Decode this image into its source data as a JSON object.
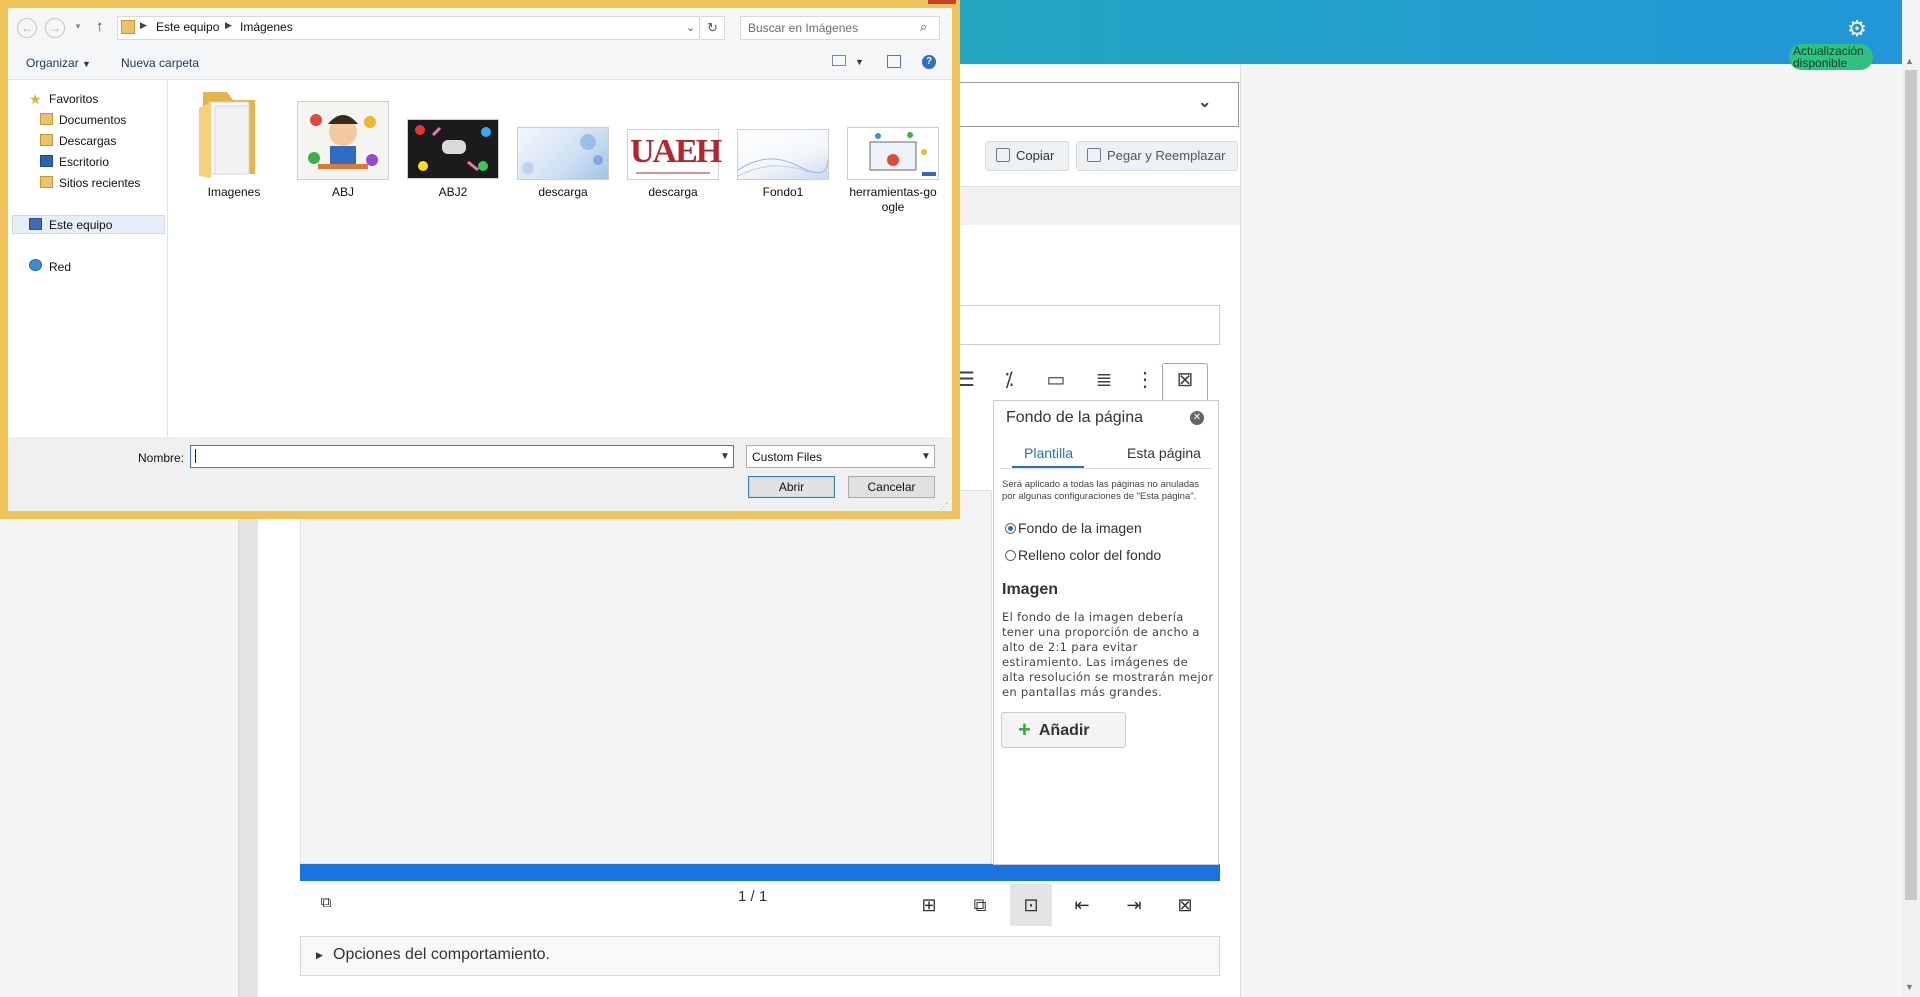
{
  "app": {
    "update_badge": "Actualización disponible",
    "dropdown_chev": "⌄",
    "copy_label": "Copiar",
    "paste_label": "Pegar y Reemplazar",
    "page_indicator": "1 / 1",
    "options_label": "Opciones del comportamiento.",
    "accent_color": "#1a74e0"
  },
  "panel": {
    "title": "Fondo de la página",
    "tabs": [
      "Plantilla",
      "Esta página"
    ],
    "active_tab": "Plantilla",
    "note": "Será aplicado a todas las páginas no anuladas por algunas configuraciones de \"Esta página\".",
    "radio_options": [
      "Fondo de la imagen",
      "Relleno color del fondo"
    ],
    "selected_radio": "Fondo de la imagen",
    "section_heading": "Imagen",
    "section_desc": "El fondo de la imagen debería tener una proporción de ancho a alto de 2:1 para evitar estiramiento. Las imágenes de alta resolución se mostrarán mejor en pantallas más grandes.",
    "add_label": "Añadir"
  },
  "dialog": {
    "address": [
      "Este equipo",
      "Imágenes"
    ],
    "search_placeholder": "Buscar en Imágenes",
    "organize_label": "Organizar",
    "new_folder_label": "Nueva carpeta",
    "tree": {
      "favorites": "Favoritos",
      "documents": "Documentos",
      "downloads": "Descargas",
      "desktop": "Escritorio",
      "recent": "Sitios recientes",
      "this_pc": "Este equipo",
      "network": "Red"
    },
    "files": [
      "Imagenes",
      "ABJ",
      "ABJ2",
      "descarga",
      "descarga",
      "Fondo1",
      "herramientas-google"
    ],
    "file_label_herramientas_line1": "herramientas-go",
    "file_label_herramientas_line2": "ogle",
    "uaeh_logo_text": "UAEH",
    "name_label": "Nombre:",
    "name_value": "",
    "filetype_value": "Custom Files",
    "open_label": "Abrir",
    "cancel_label": "Cancelar"
  }
}
